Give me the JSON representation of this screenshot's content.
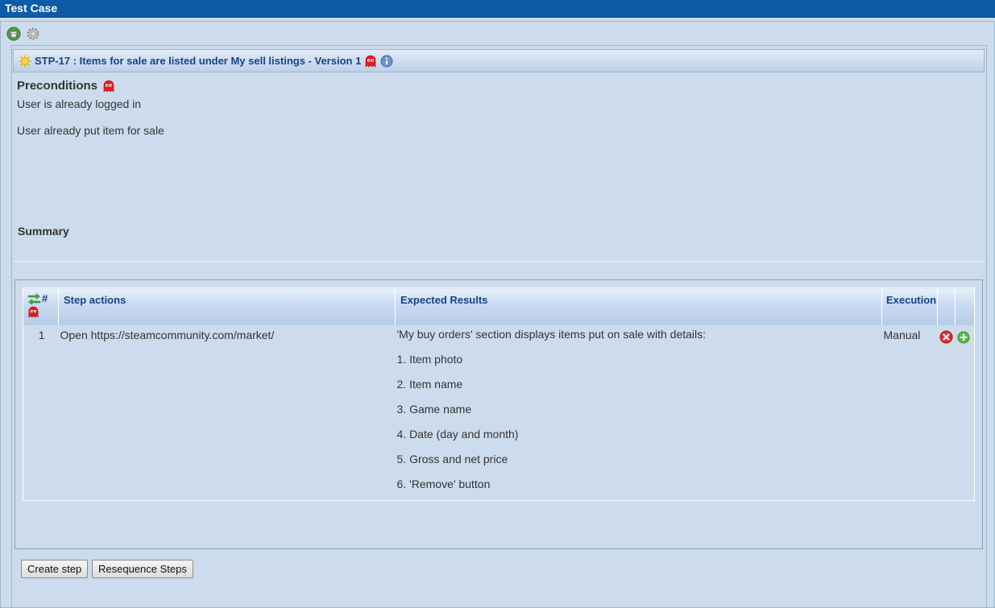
{
  "window": {
    "title": "Test Case"
  },
  "toolbar": {
    "icons": [
      "print-icon",
      "settings-gear-icon"
    ]
  },
  "testcase": {
    "header": "STP-17 : Items for sale are listed under My sell listings - Version 1",
    "preconditions_label": "Preconditions",
    "preconditions": [
      "User is already logged in",
      "User already put item for sale"
    ],
    "summary_label": "Summary"
  },
  "steps_table": {
    "columns": {
      "number": "#",
      "actions": "Step actions",
      "expected": "Expected Results",
      "execution": "Execution"
    },
    "rows": [
      {
        "number": "1",
        "action": "Open https://steamcommunity.com/market/",
        "expected": [
          "'My buy orders' section displays items put on sale with details:",
          "1. Item photo",
          "2. Item name",
          "3. Game name",
          "4. Date (day and month)",
          "5. Gross and net price",
          "6. 'Remove' button"
        ],
        "execution": "Manual"
      }
    ]
  },
  "buttons": {
    "create_step": "Create step",
    "resequence": "Resequence Steps"
  },
  "colors": {
    "titlebar": "#0d5aa7",
    "background": "#cddcec",
    "header_text": "#15428b"
  }
}
